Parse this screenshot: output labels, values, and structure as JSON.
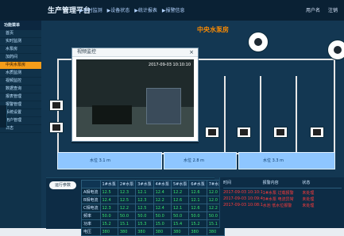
{
  "app": {
    "title": "生产管理平台",
    "nav": [
      "▶实时监测",
      "▶设备状态",
      "▶统计报表",
      "▶报警信息"
    ],
    "user": [
      "用户名",
      "注销"
    ]
  },
  "sidebar": {
    "header": "功能菜单",
    "items": [
      {
        "label": "首页",
        "active": false
      },
      {
        "label": "实时监测",
        "active": false
      },
      {
        "label": "水泵房",
        "active": false
      },
      {
        "label": "加药间",
        "active": false
      },
      {
        "label": "中央水泵房",
        "active": true
      },
      {
        "label": "水质监测",
        "active": false
      },
      {
        "label": "视频监控",
        "active": false
      },
      {
        "label": "数据查询",
        "active": false
      },
      {
        "label": "报表管理",
        "active": false
      },
      {
        "label": "报警管理",
        "active": false
      },
      {
        "label": "系统设置",
        "active": false
      },
      {
        "label": "用户管理",
        "active": false
      },
      {
        "label": "日志",
        "active": false
      }
    ]
  },
  "main": {
    "title": "中央水泵房"
  },
  "video_popup": {
    "title": "视频监控",
    "overlay": "2017-09-03 10:10:10"
  },
  "levels": {
    "tank_1": "水位 3.1 m",
    "tank_2": "水位 2.8 m",
    "tank_3": "水位 3.3 m"
  },
  "table": {
    "button": "运行参数",
    "columns": [
      "",
      "1#水泵",
      "2#水泵",
      "3#水泵",
      "4#水泵",
      "5#水泵",
      "6#水泵",
      "7#水泵"
    ],
    "rows": [
      {
        "label": "A相电流",
        "values": [
          "12.5",
          "12.3",
          "12.1",
          "12.4",
          "12.2",
          "12.6",
          "12.0"
        ]
      },
      {
        "label": "B相电流",
        "values": [
          "12.4",
          "12.5",
          "12.3",
          "12.2",
          "12.6",
          "12.1",
          "12.0"
        ]
      },
      {
        "label": "C相电流",
        "values": [
          "12.3",
          "12.2",
          "12.5",
          "12.4",
          "12.1",
          "12.6",
          "12.2"
        ]
      },
      {
        "label": "频率",
        "values": [
          "50.0",
          "50.0",
          "50.0",
          "50.0",
          "50.0",
          "50.0",
          "50.0"
        ]
      },
      {
        "label": "功率",
        "values": [
          "15.2",
          "15.1",
          "15.3",
          "15.0",
          "15.4",
          "15.2",
          "15.1"
        ]
      },
      {
        "label": "电压",
        "values": [
          "380",
          "380",
          "380",
          "380",
          "380",
          "380",
          "380"
        ]
      }
    ]
  },
  "alarms": {
    "headers": [
      "时间",
      "报警内容",
      "状态"
    ],
    "rows": [
      [
        "2017-09-03 10:10:10",
        "1#水泵 过载报警",
        "未处理"
      ],
      [
        "2017-09-03 10:09:42",
        "3#水泵 电流异常",
        "未处理"
      ],
      [
        "2017-09-03 10:08:11",
        "水池 低水位报警",
        "未处理"
      ]
    ]
  }
}
